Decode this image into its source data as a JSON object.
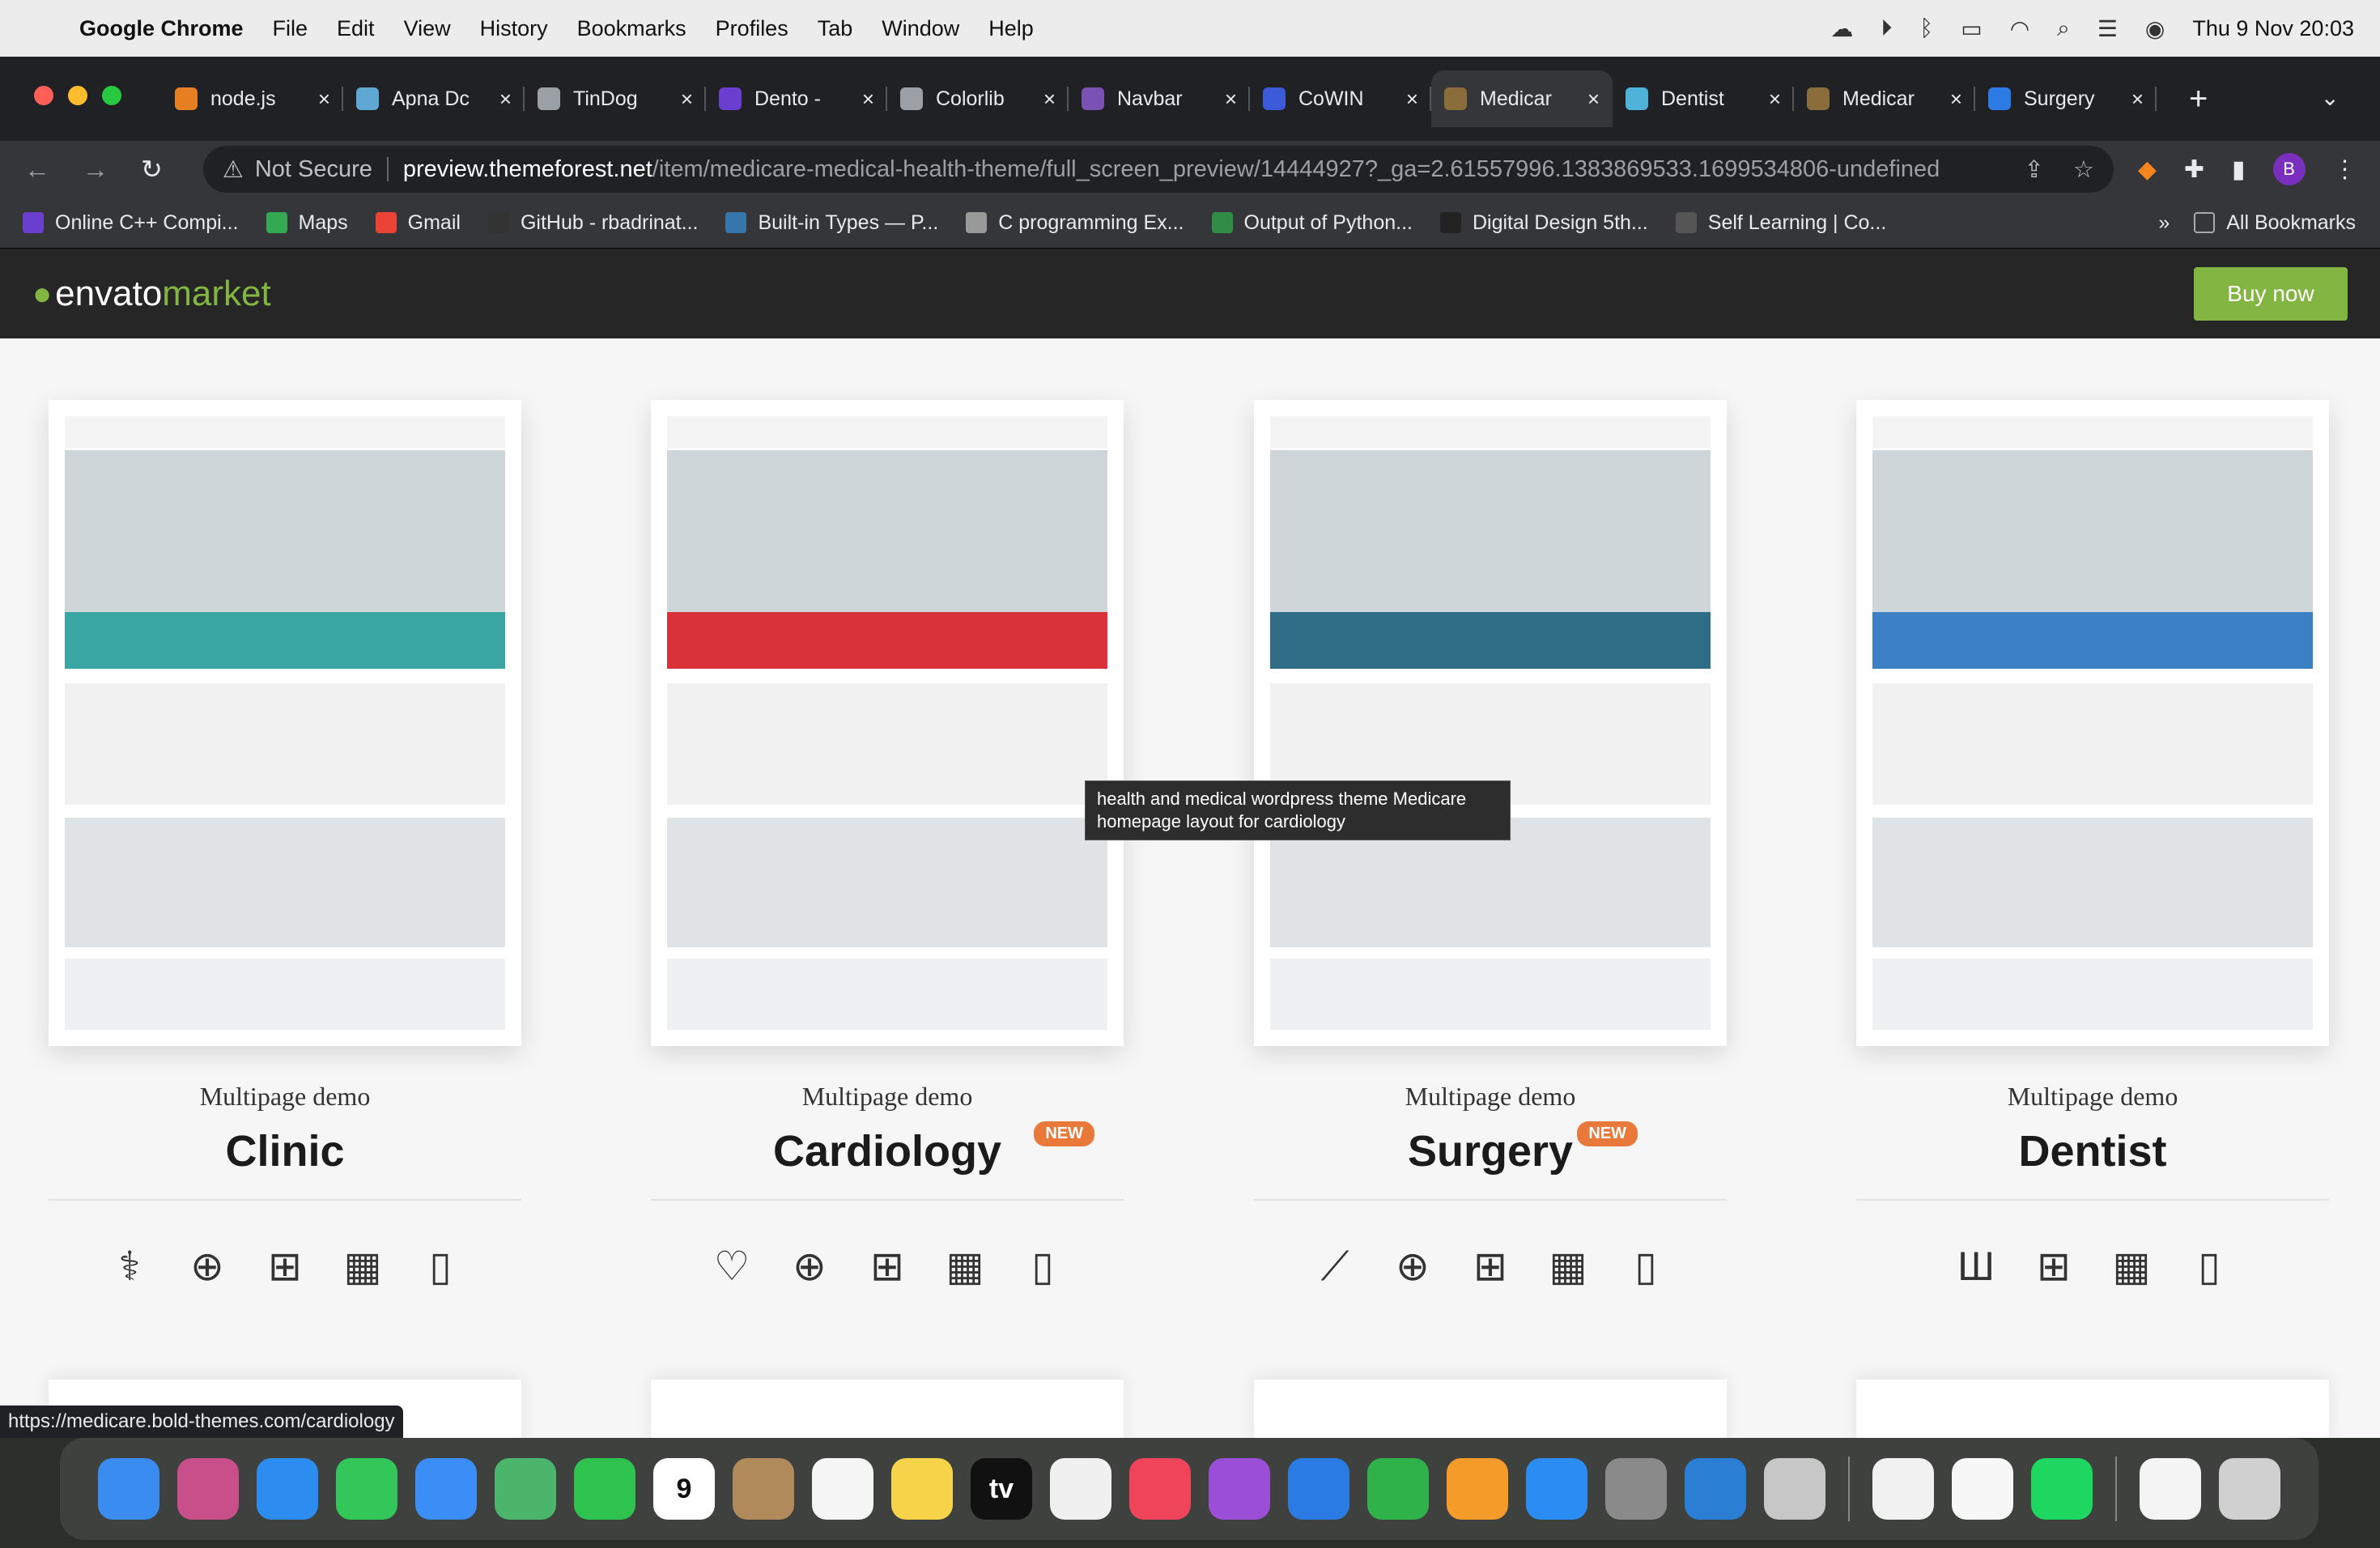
{
  "menubar": {
    "app": "Google Chrome",
    "items": [
      "File",
      "Edit",
      "View",
      "History",
      "Bookmarks",
      "Profiles",
      "Tab",
      "Window",
      "Help"
    ],
    "datetime": "Thu 9 Nov  20:03"
  },
  "tabs": [
    {
      "title": "node.js",
      "color": "#e67e22"
    },
    {
      "title": "Apna Dc",
      "color": "#5fa8d3"
    },
    {
      "title": "TinDog",
      "color": "#9aa0a6"
    },
    {
      "title": "Dento -",
      "color": "#6a3fd0"
    },
    {
      "title": "Colorlib",
      "color": "#9aa0a6"
    },
    {
      "title": "Navbar",
      "color": "#7952b3"
    },
    {
      "title": "CoWIN",
      "color": "#3b5bdb"
    },
    {
      "title": "Medicar",
      "color": "#8a6d3b",
      "active": true
    },
    {
      "title": "Dentist",
      "color": "#4fb3d9"
    },
    {
      "title": "Medicar",
      "color": "#8a6d3b"
    },
    {
      "title": "Surgery",
      "color": "#2c7be5"
    }
  ],
  "address": {
    "security": "Not Secure",
    "host": "preview.themeforest.net",
    "path": "/item/medicare-medical-health-theme/full_screen_preview/14444927?_ga=2.61557996.1383869533.1699534806-undefined"
  },
  "profile_initial": "B",
  "bookmarks": [
    {
      "label": "Online C++ Compi...",
      "color": "#6a3fd0"
    },
    {
      "label": "Maps",
      "color": "#34a853"
    },
    {
      "label": "Gmail",
      "color": "#ea4335"
    },
    {
      "label": "GitHub - rbadrinat...",
      "color": "#333"
    },
    {
      "label": "Built-in Types — P...",
      "color": "#3776ab"
    },
    {
      "label": "C programming Ex...",
      "color": "#999"
    },
    {
      "label": "Output of Python...",
      "color": "#2f8d46"
    },
    {
      "label": "Digital Design 5th...",
      "color": "#222"
    },
    {
      "label": "Self Learning | Co...",
      "color": "#555"
    }
  ],
  "bookmarks_more": "»",
  "all_bookmarks": "All Bookmarks",
  "envato": {
    "brand": "envato",
    "market": "market",
    "buy": "Buy now"
  },
  "demos": [
    {
      "caption": "Multipage demo",
      "title": "Clinic",
      "badge": "",
      "icons": [
        "stethoscope-icon",
        "medical-bag-icon",
        "calculator-icon",
        "calendar-icon",
        "mobile-icon"
      ],
      "accent": "#3aa6a3"
    },
    {
      "caption": "Multipage demo",
      "title": "Cardiology",
      "badge": "NEW",
      "icons": [
        "heart-icon",
        "medical-bag-icon",
        "calculator-icon",
        "calendar-icon",
        "mobile-icon"
      ],
      "accent": "#d9313a"
    },
    {
      "caption": "Multipage demo",
      "title": "Surgery",
      "badge": "NEW",
      "icons": [
        "scalpel-icon",
        "medical-bag-icon",
        "calculator-icon",
        "calendar-icon",
        "mobile-icon"
      ],
      "accent": "#2f6d86"
    },
    {
      "caption": "Multipage demo",
      "title": "Dentist",
      "badge": "",
      "icons": [
        "tooth-icon",
        "calculator-icon",
        "calendar-icon",
        "mobile-icon"
      ],
      "accent": "#3b7fc4"
    }
  ],
  "tooltip": "health and medical wordpress theme Medicare homepage layout for cardiology",
  "status_url": "https://medicare.bold-themes.com/cardiology",
  "dock": [
    {
      "name": "finder",
      "color": "#3b8cf0"
    },
    {
      "name": "launchpad",
      "color": "#c94f8a"
    },
    {
      "name": "safari",
      "color": "#2d8cf0"
    },
    {
      "name": "messages",
      "color": "#33c75a"
    },
    {
      "name": "mail",
      "color": "#3a8ef6"
    },
    {
      "name": "maps",
      "color": "#4bb56b"
    },
    {
      "name": "facetime",
      "color": "#2ec24f"
    },
    {
      "name": "calendar",
      "color": "#fff",
      "label": "9"
    },
    {
      "name": "contacts",
      "color": "#b08a5a"
    },
    {
      "name": "reminders",
      "color": "#f5f5f5"
    },
    {
      "name": "notes",
      "color": "#f7d34a"
    },
    {
      "name": "tv",
      "color": "#111",
      "label": "tv"
    },
    {
      "name": "photos",
      "color": "#f0f0f0"
    },
    {
      "name": "music",
      "color": "#f0445a"
    },
    {
      "name": "podcasts",
      "color": "#9b4fd6"
    },
    {
      "name": "keynote",
      "color": "#2a7be4"
    },
    {
      "name": "numbers",
      "color": "#2fb24a"
    },
    {
      "name": "pages",
      "color": "#f59b2a"
    },
    {
      "name": "app-store",
      "color": "#2b8cf3"
    },
    {
      "name": "system-settings",
      "color": "#8a8a8a"
    },
    {
      "name": "vscode",
      "color": "#2a7fd4"
    },
    {
      "name": "preview",
      "color": "#c7c7c7"
    },
    {
      "name": "chrome",
      "color": "#f1f1f1"
    },
    {
      "name": "textedit",
      "color": "#f7f7f7"
    },
    {
      "name": "spotify",
      "color": "#1ed760"
    },
    {
      "name": "document",
      "color": "#f4f4f4"
    },
    {
      "name": "trash",
      "color": "#d0d0d0"
    }
  ]
}
